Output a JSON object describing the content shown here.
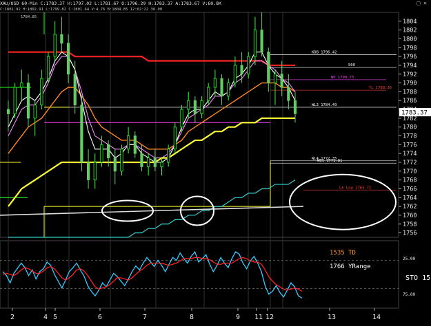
{
  "header": {
    "symbol": "XAU/USD 60-Min",
    "ohlc": "C:1783.37 H:1797.02 L:1781.67 O:1796.29 H:1783.37 A:1783.67 V:60.8K",
    "line2": "1784.85",
    "line3": "C:1801.92 H:1802.91 L:1799.82 C:1801.64 V:4.76 B:1804.85 12:02:22 36.00",
    "icons": "□ ✕"
  },
  "colors": {
    "background": "#000000",
    "candle_up": "#22ff22",
    "candle_down": "#66cc66",
    "red_trend": "#ff2222",
    "yellow_ma": "#ffff33",
    "orange_ma": "#ff8822",
    "pink_ma": "#ff88ff",
    "white_ma": "#ffffff",
    "cyan_line": "#33cccc",
    "osc_cyan": "#33ccff",
    "osc_red": "#ff2222"
  },
  "chart_data": [
    {
      "type": "candlestick",
      "title": "XAU/USD 60-Min",
      "ylim": [
        1755,
        1806
      ],
      "y_ticks": [
        1804,
        1802,
        1800,
        1798,
        1796,
        1794,
        1792,
        1790,
        1788,
        1786,
        1784,
        1782,
        1780,
        1778,
        1776,
        1774,
        1772,
        1770,
        1768,
        1766,
        1764,
        1762,
        1760,
        1758,
        1756
      ],
      "x_ticks": [
        "2",
        "4",
        "5",
        "6",
        "7",
        "8",
        "9",
        "11",
        "12",
        "13",
        "14"
      ],
      "last_price": "1783.37",
      "candles": [
        [
          1784,
          1786,
          1779,
          1783
        ],
        [
          1783,
          1790,
          1782,
          1789
        ],
        [
          1789,
          1793,
          1786,
          1790
        ],
        [
          1790,
          1792,
          1780,
          1782
        ],
        [
          1782,
          1786,
          1778,
          1785
        ],
        [
          1785,
          1793,
          1784,
          1791
        ],
        [
          1791,
          1797,
          1790,
          1796
        ],
        [
          1796,
          1804,
          1795,
          1801
        ],
        [
          1801,
          1805,
          1797,
          1799
        ],
        [
          1799,
          1801,
          1790,
          1792
        ],
        [
          1792,
          1795,
          1783,
          1785
        ],
        [
          1785,
          1787,
          1770,
          1772
        ],
        [
          1772,
          1775,
          1766,
          1768
        ],
        [
          1768,
          1774,
          1766,
          1772
        ],
        [
          1772,
          1778,
          1771,
          1776
        ],
        [
          1776,
          1777,
          1771,
          1773
        ],
        [
          1773,
          1775,
          1767,
          1770
        ],
        [
          1770,
          1776,
          1769,
          1775
        ],
        [
          1775,
          1780,
          1774,
          1778
        ],
        [
          1778,
          1779,
          1773,
          1774
        ],
        [
          1774,
          1776,
          1770,
          1771
        ],
        [
          1771,
          1774,
          1769,
          1773
        ],
        [
          1773,
          1775,
          1770,
          1771
        ],
        [
          1771,
          1773,
          1769,
          1772
        ],
        [
          1772,
          1776,
          1771,
          1775
        ],
        [
          1775,
          1781,
          1774,
          1780
        ],
        [
          1780,
          1785,
          1779,
          1784
        ],
        [
          1784,
          1788,
          1782,
          1786
        ],
        [
          1786,
          1787,
          1781,
          1783
        ],
        [
          1783,
          1787,
          1782,
          1786
        ],
        [
          1786,
          1790,
          1785,
          1789
        ],
        [
          1789,
          1793,
          1787,
          1791
        ],
        [
          1791,
          1792,
          1785,
          1787
        ],
        [
          1787,
          1791,
          1786,
          1790
        ],
        [
          1790,
          1796,
          1789,
          1794
        ],
        [
          1794,
          1797,
          1790,
          1792
        ],
        [
          1792,
          1797,
          1791,
          1796
        ],
        [
          1796,
          1805,
          1794,
          1802
        ],
        [
          1802,
          1806,
          1796,
          1797
        ],
        [
          1797,
          1798,
          1788,
          1790
        ],
        [
          1790,
          1793,
          1785,
          1792
        ],
        [
          1792,
          1795,
          1787,
          1789
        ],
        [
          1789,
          1792,
          1784,
          1786
        ],
        [
          1786,
          1788,
          1781,
          1783
        ]
      ],
      "moving_averages": {
        "red": [
          1797,
          1797,
          1797,
          1797,
          1797,
          1797,
          1797,
          1797,
          1797,
          1797,
          1796,
          1796,
          1796,
          1796,
          1796,
          1796,
          1796,
          1796,
          1796,
          1796,
          1796,
          1795,
          1795,
          1795,
          1795,
          1795,
          1795,
          1795,
          1795,
          1795,
          1795,
          1795,
          1795,
          1795,
          1795,
          1795,
          1795,
          1795,
          1795,
          1794,
          1794,
          1794,
          1794,
          1794
        ],
        "white": [
          1780,
          1783,
          1786,
          1787,
          1786,
          1788,
          1791,
          1795,
          1797,
          1796,
          1793,
          1786,
          1779,
          1775,
          1775,
          1775,
          1773,
          1774,
          1776,
          1776,
          1774,
          1773,
          1772,
          1772,
          1773,
          1776,
          1780,
          1783,
          1784,
          1784,
          1786,
          1788,
          1787,
          1788,
          1791,
          1792,
          1794,
          1797,
          1797,
          1794,
          1792,
          1791,
          1789,
          1786
        ],
        "pink": [
          1778,
          1781,
          1784,
          1785,
          1785,
          1787,
          1790,
          1794,
          1796,
          1796,
          1793,
          1788,
          1782,
          1778,
          1777,
          1776,
          1775,
          1775,
          1776,
          1776,
          1775,
          1774,
          1773,
          1773,
          1774,
          1776,
          1779,
          1782,
          1783,
          1784,
          1785,
          1787,
          1787,
          1788,
          1790,
          1791,
          1793,
          1795,
          1795,
          1794,
          1793,
          1791,
          1790,
          1788
        ],
        "orange": [
          1774,
          1776,
          1778,
          1780,
          1781,
          1782,
          1784,
          1786,
          1788,
          1789,
          1789,
          1787,
          1785,
          1782,
          1780,
          1779,
          1778,
          1777,
          1777,
          1777,
          1776,
          1775,
          1775,
          1775,
          1775,
          1776,
          1777,
          1779,
          1780,
          1781,
          1782,
          1783,
          1784,
          1785,
          1786,
          1787,
          1788,
          1789,
          1790,
          1790,
          1790,
          1789,
          1789,
          1788
        ],
        "yellow": [
          1762,
          1764,
          1766,
          1767,
          1768,
          1769,
          1770,
          1771,
          1772,
          1772,
          1772,
          1772,
          1772,
          1772,
          1772,
          1772,
          1772,
          1772,
          1772,
          1772,
          1772,
          1772,
          1772,
          1773,
          1773,
          1774,
          1775,
          1776,
          1777,
          1777,
          1778,
          1779,
          1779,
          1780,
          1780,
          1781,
          1781,
          1781,
          1782,
          1782,
          1782,
          1782,
          1782,
          1782
        ],
        "cyan": [
          1755,
          1755,
          1755,
          1755,
          1755,
          1755,
          1755,
          1755,
          1755,
          1755,
          1755,
          1755,
          1755,
          1755,
          1755,
          1755,
          1755,
          1755,
          1755,
          1756,
          1756,
          1757,
          1757,
          1758,
          1758,
          1759,
          1759,
          1760,
          1760,
          1761,
          1761,
          1762,
          1762,
          1763,
          1764,
          1764,
          1765,
          1765,
          1766,
          1766,
          1767,
          1767,
          1767,
          1768
        ]
      },
      "horizontal_levels": [
        {
          "label": "KDB 1796.42",
          "value": 1796.42,
          "color": "#ffffff"
        },
        {
          "label": "500",
          "value": 1793.5,
          "color": "#ffffff"
        },
        {
          "label": "WP 1790.73",
          "value": 1790.73,
          "color": "#ff44ff"
        },
        {
          "label": "YL 1788.36",
          "value": 1788.36,
          "color": "#ff4444"
        },
        {
          "label": "WL3 1784.49",
          "value": 1784.49,
          "color": "#ffffff"
        },
        {
          "label": "WL4 1772.35",
          "value": 1772.35,
          "color": "#ffffff"
        },
        {
          "label": "WB1 1771.81",
          "value": 1771.81,
          "color": "#ffffff"
        },
        {
          "label": "Lk Low 1765.72",
          "value": 1765.72,
          "color": "#ff4444"
        }
      ]
    },
    {
      "type": "line",
      "name": "STO",
      "period": "15",
      "ylim": [
        0,
        100
      ],
      "y_ticks": [
        "25.00",
        "75.00"
      ],
      "annotations": [
        "1535 TD",
        "1766 YRange"
      ],
      "series": [
        {
          "name": "K",
          "color": "#33ccff",
          "values": [
            55,
            48,
            35,
            52,
            61,
            70,
            62,
            48,
            58,
            42,
            55,
            60,
            72,
            66,
            50,
            38,
            26,
            40,
            55,
            62,
            70,
            58,
            47,
            30,
            20,
            12,
            22,
            35,
            28,
            40,
            52,
            46,
            38,
            30,
            42,
            55,
            65,
            58,
            70,
            80,
            72,
            64,
            75,
            66,
            55,
            68,
            80,
            75,
            88,
            78,
            70,
            82,
            90,
            72,
            78,
            85,
            68,
            55,
            66,
            80,
            70,
            62,
            78,
            90,
            86,
            70,
            60,
            74,
            82,
            70,
            55,
            30,
            15,
            20,
            30,
            18,
            10,
            22,
            35,
            28,
            12,
            8
          ]
        },
        {
          "name": "D",
          "color": "#ff2222",
          "values": [
            50,
            52,
            50,
            48,
            52,
            58,
            62,
            60,
            56,
            52,
            52,
            56,
            62,
            64,
            60,
            52,
            44,
            40,
            44,
            50,
            58,
            60,
            56,
            48,
            38,
            28,
            24,
            26,
            28,
            32,
            38,
            44,
            44,
            42,
            40,
            44,
            50,
            56,
            60,
            66,
            70,
            70,
            70,
            70,
            68,
            66,
            68,
            70,
            74,
            78,
            78,
            78,
            80,
            80,
            78,
            78,
            76,
            72,
            68,
            68,
            70,
            70,
            70,
            74,
            78,
            80,
            78,
            74,
            72,
            72,
            68,
            58,
            46,
            38,
            32,
            28,
            24,
            22,
            24,
            26,
            24,
            20
          ]
        }
      ]
    }
  ]
}
